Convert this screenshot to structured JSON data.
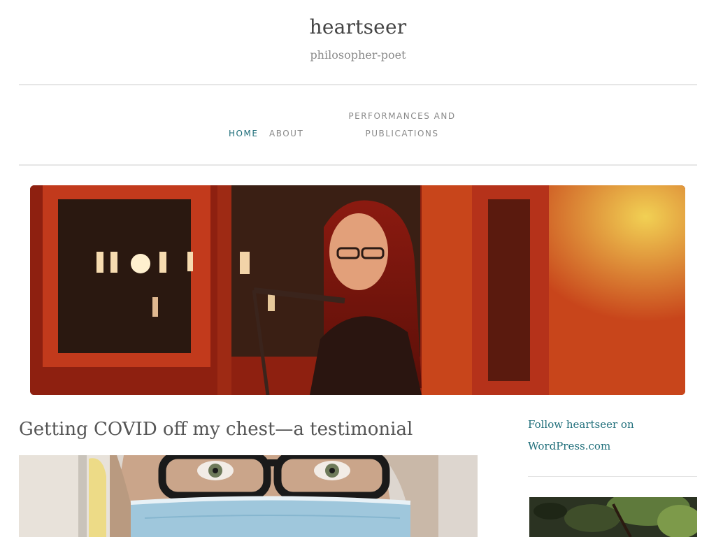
{
  "site": {
    "title": "heartseer",
    "tagline": "philosopher-poet"
  },
  "nav": {
    "home": "HOME",
    "about": "ABOUT",
    "performances_line1": "PERFORMANCES AND",
    "performances_line2": "PUBLICATIONS"
  },
  "post": {
    "title": "Getting COVID off my chest—a testimonial"
  },
  "sidebar": {
    "follow_line1": "Follow heartseer on",
    "follow_line2": "WordPress.com"
  },
  "colors": {
    "accent": "#1f6e7a",
    "title_text": "#444444",
    "muted_text": "#8a8a8a",
    "rule": "#e6e6e6"
  }
}
